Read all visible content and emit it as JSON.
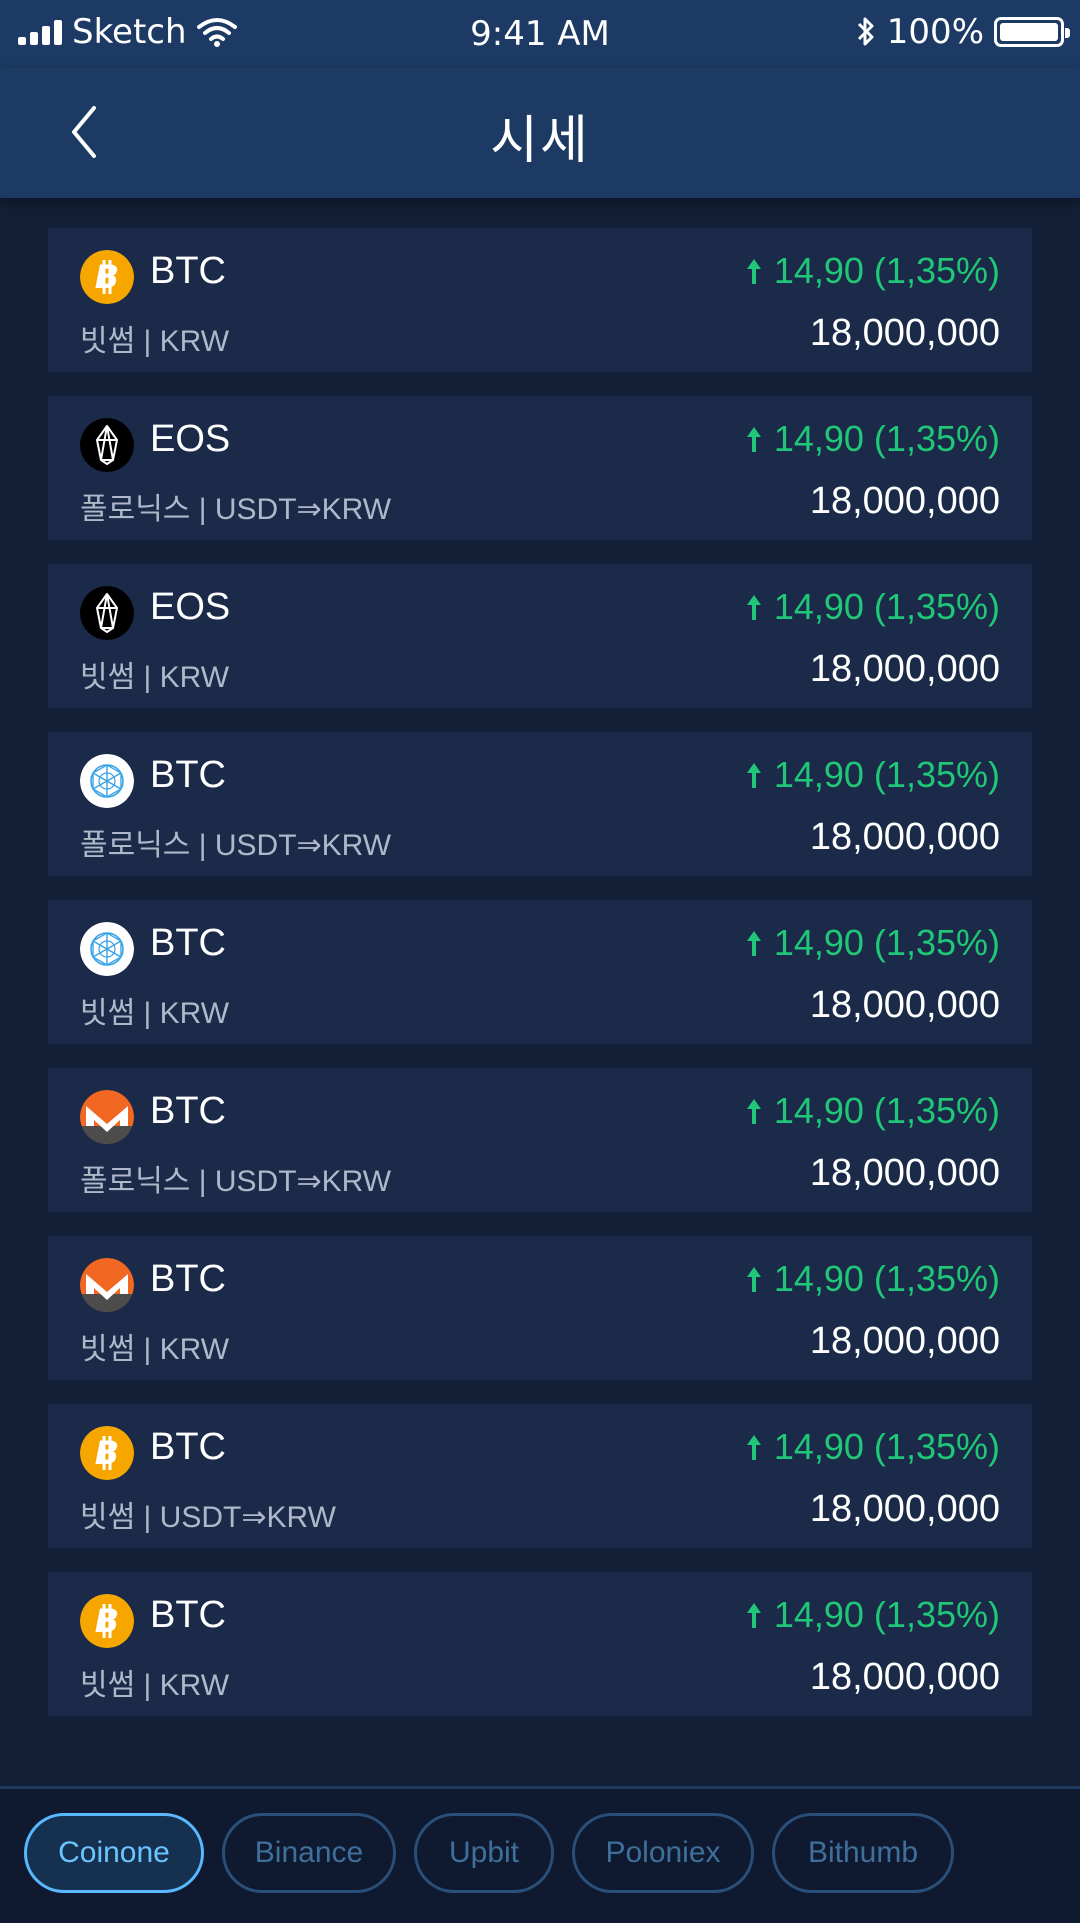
{
  "status_bar": {
    "carrier": "Sketch",
    "time": "9:41 AM",
    "battery": "100%"
  },
  "nav": {
    "title": "시세"
  },
  "rows": [
    {
      "icon": "bitcoin-icon",
      "symbol": "BTC",
      "market": "빗썸 | KRW",
      "change": "14,90 (1,35%)",
      "price": "18,000,000"
    },
    {
      "icon": "eos-icon",
      "symbol": "EOS",
      "market": "폴로닉스 | USDT⇒KRW",
      "change": "14,90 (1,35%)",
      "price": "18,000,000"
    },
    {
      "icon": "eos-icon",
      "symbol": "EOS",
      "market": "빗썸 | KRW",
      "change": "14,90 (1,35%)",
      "price": "18,000,000"
    },
    {
      "icon": "qtum-icon",
      "symbol": "BTC",
      "market": "폴로닉스 | USDT⇒KRW",
      "change": "14,90 (1,35%)",
      "price": "18,000,000"
    },
    {
      "icon": "qtum-icon",
      "symbol": "BTC",
      "market": "빗썸 | KRW",
      "change": "14,90 (1,35%)",
      "price": "18,000,000"
    },
    {
      "icon": "monero-icon",
      "symbol": "BTC",
      "market": "폴로닉스 | USDT⇒KRW",
      "change": "14,90 (1,35%)",
      "price": "18,000,000"
    },
    {
      "icon": "monero-icon",
      "symbol": "BTC",
      "market": "빗썸 | KRW",
      "change": "14,90 (1,35%)",
      "price": "18,000,000"
    },
    {
      "icon": "bitcoin-icon",
      "symbol": "BTC",
      "market": "빗썸 | USDT⇒KRW",
      "change": "14,90 (1,35%)",
      "price": "18,000,000"
    },
    {
      "icon": "bitcoin-icon",
      "symbol": "BTC",
      "market": "빗썸 | KRW",
      "change": "14,90 (1,35%)",
      "price": "18,000,000"
    }
  ],
  "exchanges": [
    {
      "label": "Coinone",
      "active": true
    },
    {
      "label": "Binance",
      "active": false
    },
    {
      "label": "Upbit",
      "active": false
    },
    {
      "label": "Poloniex",
      "active": false
    },
    {
      "label": "Bithumb",
      "active": false
    }
  ],
  "colors": {
    "up": "#1fc776",
    "header": "#1c3a63",
    "card": "#1a2a48",
    "background": "#142038"
  }
}
